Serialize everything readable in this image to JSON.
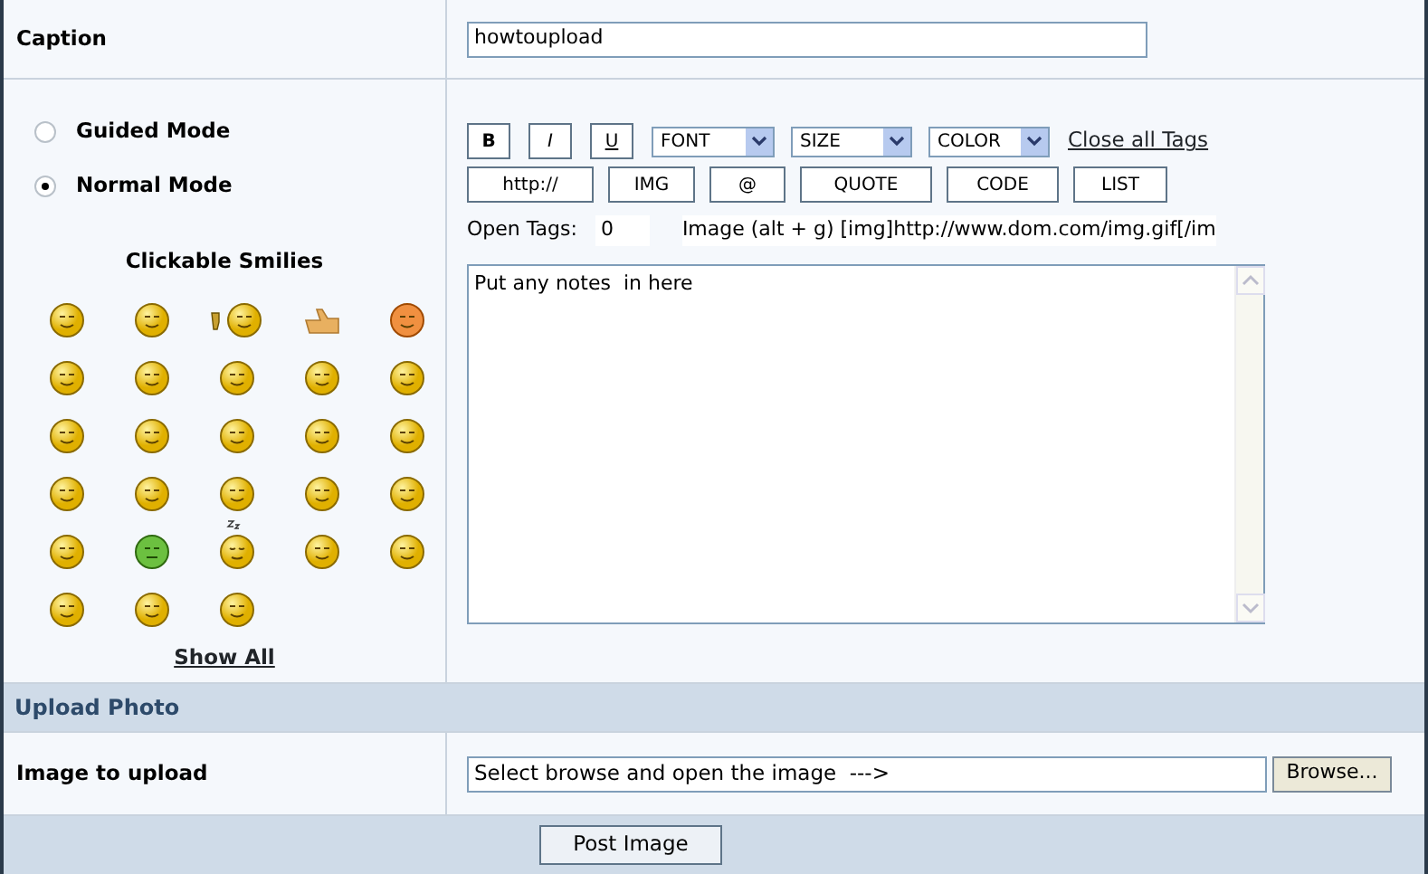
{
  "caption": {
    "label": "Caption",
    "value": "howtoupload"
  },
  "modes": [
    {
      "label": "Guided Mode",
      "selected": false
    },
    {
      "label": "Normal Mode",
      "selected": true
    }
  ],
  "smilies_title": "Clickable Smilies",
  "smilies": [
    {
      "kind": "face"
    },
    {
      "kind": "face"
    },
    {
      "kind": "thumbs-down-face"
    },
    {
      "kind": "hand"
    },
    {
      "kind": "orange-face"
    },
    {
      "kind": "face"
    },
    {
      "kind": "face"
    },
    {
      "kind": "face"
    },
    {
      "kind": "face"
    },
    {
      "kind": "face"
    },
    {
      "kind": "face"
    },
    {
      "kind": "face"
    },
    {
      "kind": "face"
    },
    {
      "kind": "face"
    },
    {
      "kind": "face"
    },
    {
      "kind": "face"
    },
    {
      "kind": "face"
    },
    {
      "kind": "face"
    },
    {
      "kind": "face"
    },
    {
      "kind": "face"
    },
    {
      "kind": "face"
    },
    {
      "kind": "green-face"
    },
    {
      "kind": "sleepy-face"
    },
    {
      "kind": "face"
    },
    {
      "kind": "face"
    },
    {
      "kind": "face"
    },
    {
      "kind": "face"
    },
    {
      "kind": "face"
    }
  ],
  "show_all": "Show All",
  "toolbar_row1": [
    {
      "kind": "bold",
      "label": "B"
    },
    {
      "kind": "italic",
      "label": "I"
    },
    {
      "kind": "underline",
      "label": "U"
    },
    {
      "kind": "select",
      "label": "FONT"
    },
    {
      "kind": "select",
      "label": "SIZE"
    },
    {
      "kind": "select",
      "label": "COLOR"
    },
    {
      "kind": "link",
      "label": "Close all Tags"
    }
  ],
  "toolbar_row2": [
    "http://",
    "IMG",
    "@",
    "QUOTE",
    "CODE",
    "LIST"
  ],
  "open_tags": {
    "label": "Open Tags:",
    "value": "0"
  },
  "hint": "Image (alt + g) [img]http://www.dom.com/img.gif[/im",
  "notes": "Put any notes  in here",
  "upload_section": "Upload Photo",
  "image_field": {
    "label": "Image to upload",
    "value": "Select browse and open the image  --->",
    "button": "Browse..."
  },
  "submit": "Post Image"
}
